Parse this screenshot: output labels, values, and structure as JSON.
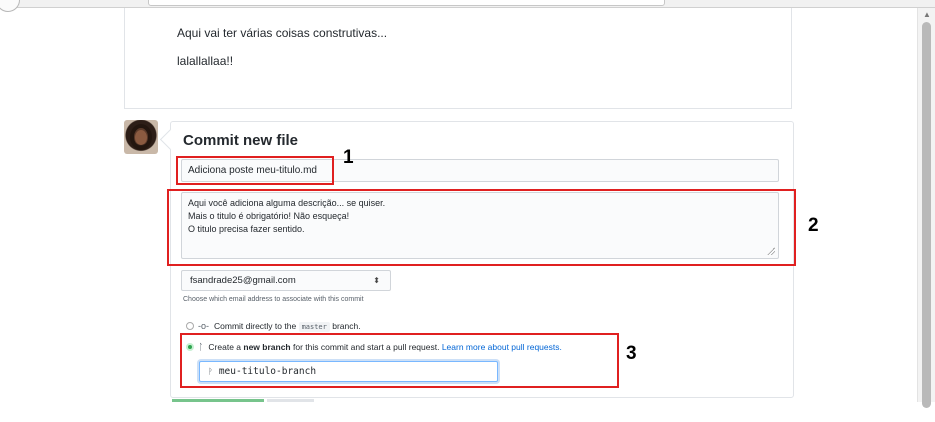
{
  "preview": {
    "line1": "Aqui vai ter várias coisas construtivas...",
    "line2": "lalallallaa!!"
  },
  "commit": {
    "title": "Commit new file",
    "summary_value": "Adiciona poste meu-titulo.md",
    "description_lines": [
      "Aqui você adiciona alguma descrição... se quiser.",
      "Mais o titulo é obrigatório! Não esqueça!",
      "O titulo precisa fazer sentido."
    ],
    "email_selected": "fsandrade25@gmail.com",
    "email_caret": "⬍",
    "email_note": "Choose which email address to associate with this commit",
    "option_direct": {
      "icon": "git-commit-icon",
      "prefix": "Commit directly to the",
      "branch": "master",
      "suffix": "branch."
    },
    "option_new": {
      "icon": "git-pull-request-icon",
      "prefix": "Create a",
      "bold": "new branch",
      "suffix": "for this commit and start a pull request.",
      "link": "Learn more about pull requests."
    },
    "branch_value": "meu-titulo-branch"
  },
  "annotations": {
    "label1": "1",
    "label2": "2",
    "label3": "3"
  },
  "colors": {
    "annotation": "#e02020",
    "accent_green": "#2ea44f",
    "link": "#0366d6"
  }
}
